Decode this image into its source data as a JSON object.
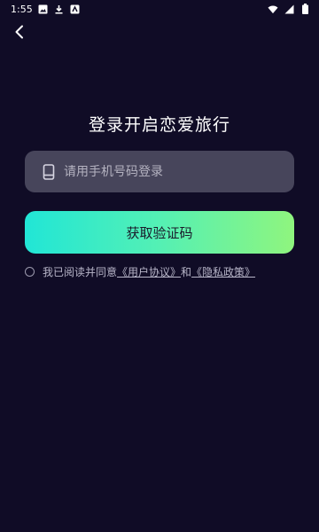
{
  "status_bar": {
    "time": "1:55",
    "left_icons": [
      "image-icon",
      "download-icon",
      "app-icon"
    ],
    "right_icons": [
      "wifi-icon",
      "signal-icon",
      "battery-icon"
    ]
  },
  "header": {
    "back_icon": "chevron-left-icon"
  },
  "login": {
    "title": "登录开启恋爱旅行",
    "phone_placeholder": "请用手机号码登录",
    "phone_value": "",
    "submit_label": "获取验证码"
  },
  "agreement": {
    "prefix": "我已阅读并同意",
    "user_agreement": "《用户协议》",
    "conjunction": "和",
    "privacy_policy": "《隐私政策》"
  },
  "colors": {
    "background": "#100c26",
    "input_bg": "#47455b",
    "gradient_start": "#21e6d6",
    "gradient_end": "#8ff57e"
  }
}
